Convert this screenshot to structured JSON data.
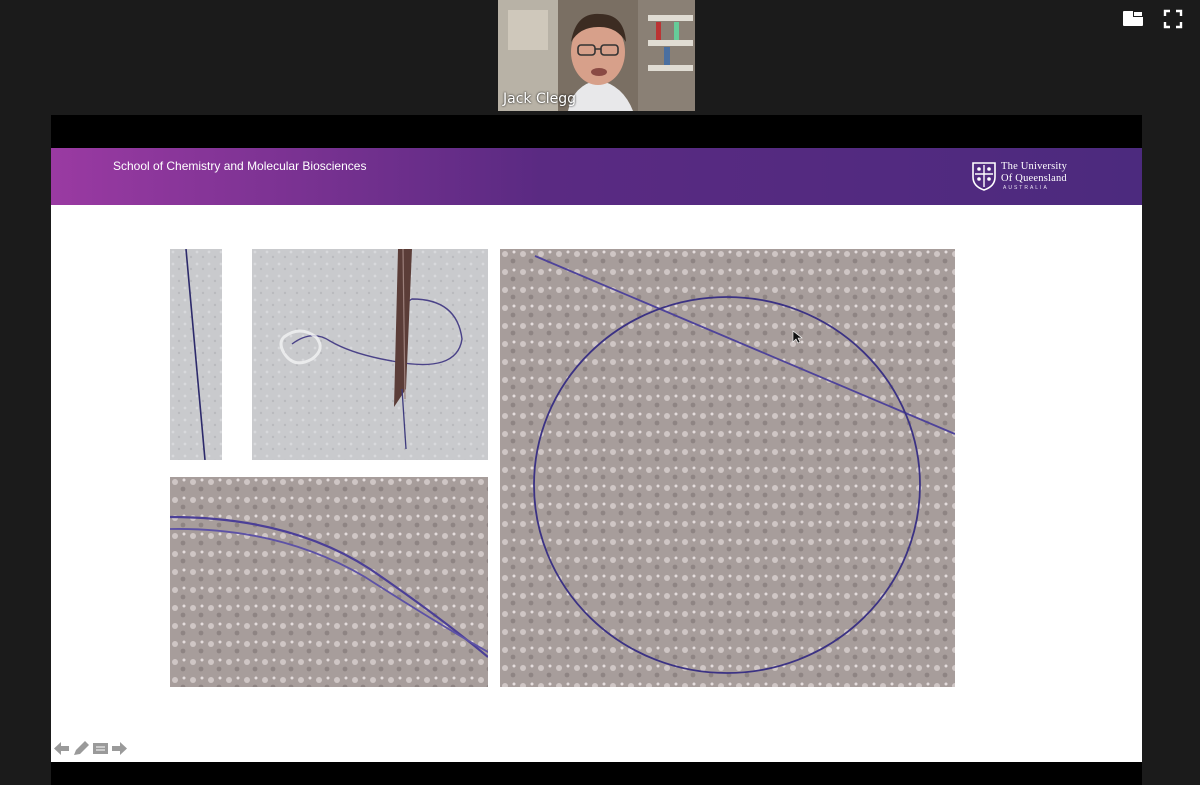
{
  "window": {
    "controls": [
      {
        "icon": "layout-toggle-icon"
      },
      {
        "icon": "fullscreen-icon"
      }
    ]
  },
  "webcam": {
    "participant_name": "Jack Clegg"
  },
  "slide": {
    "header_text": "School of Chemistry and Molecular Biosciences",
    "logo": {
      "line1": "The University",
      "line2": "Of Queensland",
      "line3": "AUSTRALIA"
    },
    "banner_colors": [
      "#9a3aa2",
      "#4c2a7e"
    ],
    "images": [
      {
        "subject": "fibre-straight"
      },
      {
        "subject": "fibre-through-needle"
      },
      {
        "subject": "fibre-curve-closeup"
      },
      {
        "subject": "fibre-circle-loop"
      }
    ]
  },
  "slide_tools": [
    {
      "icon": "previous-arrow-icon"
    },
    {
      "icon": "pen-icon"
    },
    {
      "icon": "slide-menu-icon"
    },
    {
      "icon": "next-arrow-icon"
    }
  ]
}
